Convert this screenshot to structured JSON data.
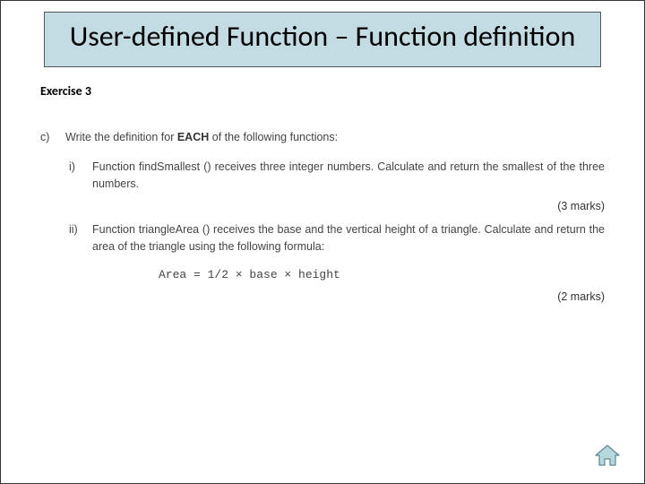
{
  "title": "User-defined Function – Function definition",
  "exercise_label": "Exercise 3",
  "section": {
    "label": "c)",
    "prompt_prefix": "Write the definition for ",
    "prompt_bold": "EACH",
    "prompt_suffix": " of the following functions:",
    "items": [
      {
        "label": "i)",
        "text": "Function findSmallest () receives three integer numbers. Calculate and return the smallest of the three numbers.",
        "marks": "(3 marks)"
      },
      {
        "label": "ii)",
        "text": "Function triangleArea () receives the base and the vertical height  of a triangle. Calculate and return the area of the triangle using the following formula:",
        "formula": "Area = 1/2 × base × height",
        "marks": "(2 marks)"
      }
    ]
  }
}
